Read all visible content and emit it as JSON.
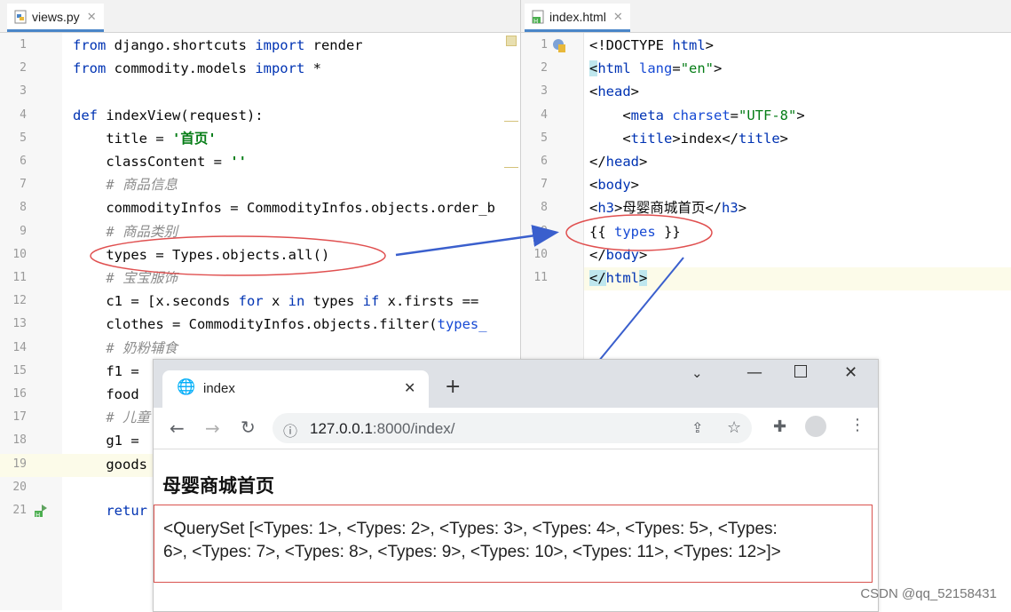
{
  "left_editor": {
    "tab_label": "views.py",
    "lines": [
      {
        "n": "1",
        "code": [
          [
            "kw",
            "from"
          ],
          [
            "",
            " django.shortcuts "
          ],
          [
            "kw",
            "import"
          ],
          [
            "",
            " render"
          ]
        ]
      },
      {
        "n": "2",
        "code": [
          [
            "kw",
            "from"
          ],
          [
            "",
            " commodity.models "
          ],
          [
            "kw",
            "import"
          ],
          [
            "",
            " *"
          ]
        ]
      },
      {
        "n": "3",
        "code": []
      },
      {
        "n": "4",
        "code": [
          [
            "kw",
            "def"
          ],
          [
            "",
            " indexView(request):"
          ]
        ]
      },
      {
        "n": "5",
        "code": [
          [
            "",
            "    title = "
          ],
          [
            "str",
            "'首页'"
          ]
        ]
      },
      {
        "n": "6",
        "code": [
          [
            "",
            "    classContent = "
          ],
          [
            "str",
            "''"
          ]
        ]
      },
      {
        "n": "7",
        "code": [
          [
            "cmt",
            "    # 商品信息"
          ]
        ]
      },
      {
        "n": "8",
        "code": [
          [
            "",
            "    commodityInfos = CommodityInfos.objects.order_b"
          ]
        ]
      },
      {
        "n": "9",
        "code": [
          [
            "cmt",
            "    # 商品类别"
          ]
        ]
      },
      {
        "n": "10",
        "code": [
          [
            "",
            "    types = Types.objects.all()"
          ]
        ]
      },
      {
        "n": "11",
        "code": [
          [
            "cmt",
            "    # 宝宝服饰"
          ]
        ]
      },
      {
        "n": "12",
        "code": [
          [
            "",
            "    c1 = [x.seconds "
          ],
          [
            "kw",
            "for"
          ],
          [
            "",
            " x "
          ],
          [
            "kw",
            "in"
          ],
          [
            "",
            " types "
          ],
          [
            "kw",
            "if"
          ],
          [
            "",
            " x.firsts =="
          ]
        ]
      },
      {
        "n": "13",
        "code": [
          [
            "",
            "    clothes = CommodityInfos.objects.filter("
          ],
          [
            "attr",
            "types_"
          ]
        ]
      },
      {
        "n": "14",
        "code": [
          [
            "cmt",
            "    # 奶粉辅食"
          ]
        ]
      },
      {
        "n": "15",
        "code": [
          [
            "",
            "    f1 ="
          ]
        ]
      },
      {
        "n": "16",
        "code": [
          [
            "",
            "    food"
          ]
        ]
      },
      {
        "n": "17",
        "code": [
          [
            "cmt",
            "    # 儿童"
          ]
        ]
      },
      {
        "n": "18",
        "code": [
          [
            "",
            "    g1 ="
          ]
        ]
      },
      {
        "n": "19",
        "code": [
          [
            "",
            "    goods"
          ]
        ]
      },
      {
        "n": "20",
        "code": []
      },
      {
        "n": "21",
        "code": [
          [
            "",
            "    "
          ],
          [
            "kw",
            "retur"
          ]
        ]
      }
    ]
  },
  "right_editor": {
    "tab_label": "index.html",
    "lines": [
      {
        "n": "1",
        "code": [
          [
            "",
            "<!DOCTYPE "
          ],
          [
            "tag",
            "html"
          ],
          [
            "",
            ">"
          ]
        ]
      },
      {
        "n": "2",
        "code": [
          [
            "hlbox",
            "<"
          ],
          [
            "tag",
            "html "
          ],
          [
            "attr",
            "lang"
          ],
          [
            "",
            "="
          ],
          [
            "aval",
            "\"en\""
          ],
          [
            "",
            ">"
          ]
        ]
      },
      {
        "n": "3",
        "code": [
          [
            "",
            "<"
          ],
          [
            "tag",
            "head"
          ],
          [
            "",
            ">"
          ]
        ]
      },
      {
        "n": "4",
        "code": [
          [
            "",
            "    <"
          ],
          [
            "tag",
            "meta "
          ],
          [
            "attr",
            "charset"
          ],
          [
            "",
            "="
          ],
          [
            "aval",
            "\"UTF-8\""
          ],
          [
            "",
            ">"
          ]
        ]
      },
      {
        "n": "5",
        "code": [
          [
            "",
            "    <"
          ],
          [
            "tag",
            "title"
          ],
          [
            "",
            ">index</"
          ],
          [
            "tag",
            "title"
          ],
          [
            "",
            ">"
          ]
        ]
      },
      {
        "n": "6",
        "code": [
          [
            "",
            "</"
          ],
          [
            "tag",
            "head"
          ],
          [
            "",
            ">"
          ]
        ]
      },
      {
        "n": "7",
        "code": [
          [
            "",
            "<"
          ],
          [
            "tag",
            "body"
          ],
          [
            "",
            ">"
          ]
        ]
      },
      {
        "n": "8",
        "code": [
          [
            "",
            "<"
          ],
          [
            "tag",
            "h3"
          ],
          [
            "",
            ">母婴商城首页</"
          ],
          [
            "tag",
            "h3"
          ],
          [
            "",
            ">"
          ]
        ]
      },
      {
        "n": "9",
        "code": [
          [
            "",
            "{{ "
          ],
          [
            "attr",
            "types"
          ],
          [
            "",
            " }}"
          ]
        ]
      },
      {
        "n": "10",
        "code": [
          [
            "",
            "</"
          ],
          [
            "tag",
            "body"
          ],
          [
            "",
            ">"
          ]
        ]
      },
      {
        "n": "11",
        "code": [
          [
            "hlbox",
            "</"
          ],
          [
            "tag",
            "html"
          ],
          [
            "hlbox",
            ">"
          ]
        ]
      }
    ]
  },
  "browser": {
    "tab_title": "index",
    "url_host": "127.0.0.1",
    "url_rest": ":8000/index/",
    "page_heading": "母婴商城首页",
    "output_line1": "<QuerySet [<Types: 1>, <Types: 2>, <Types: 3>, <Types: 4>, <Types: 5>, <Types:",
    "output_line2": "6>, <Types: 7>, <Types: 8>, <Types: 9>, <Types: 10>, <Types: 11>, <Types: 12>]>"
  },
  "watermark": "CSDN @qq_52158431",
  "colors": {
    "annotation_arrow": "#3a5fcd",
    "annotation_ellipse": "#e05050"
  }
}
